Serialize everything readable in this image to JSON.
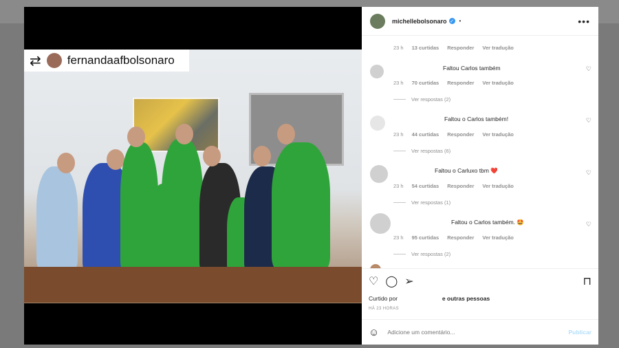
{
  "post": {
    "username": "michellebolsonaro",
    "more_label": "•••",
    "repost_icon": "repost-icon",
    "repost_username": "fernandaafbolsonaro"
  },
  "comments": [
    {
      "time": "23 h",
      "likes": "13 curtidas",
      "reply": "Responder",
      "translate": "Ver tradução"
    },
    {
      "text": "Faltou Carlos também",
      "time": "23 h",
      "likes": "70 curtidas",
      "reply": "Responder",
      "translate": "Ver tradução",
      "replies": "Ver respostas (2)"
    },
    {
      "text": "Faltou o Carlos também!",
      "time": "23 h",
      "likes": "44 curtidas",
      "reply": "Responder",
      "translate": "Ver tradução",
      "replies": "Ver respostas (6)"
    },
    {
      "text": "Faltou o Carluxo tbm ❤️",
      "time": "23 h",
      "likes": "54 curtidas",
      "reply": "Responder",
      "translate": "Ver tradução",
      "replies": "Ver respostas (1)"
    },
    {
      "text": "Faltou o Carlos também. 🤩",
      "time": "23 h",
      "likes": "95 curtidas",
      "reply": "Responder",
      "translate": "Ver tradução",
      "replies": "Ver respostas (2)"
    }
  ],
  "liked_by": {
    "prefix": "Curtido por",
    "suffix": "e outras pessoas"
  },
  "time_ago": "HÁ 23 HORAS",
  "add_comment": {
    "placeholder": "Adicione um comentário...",
    "publish": "Publicar"
  }
}
